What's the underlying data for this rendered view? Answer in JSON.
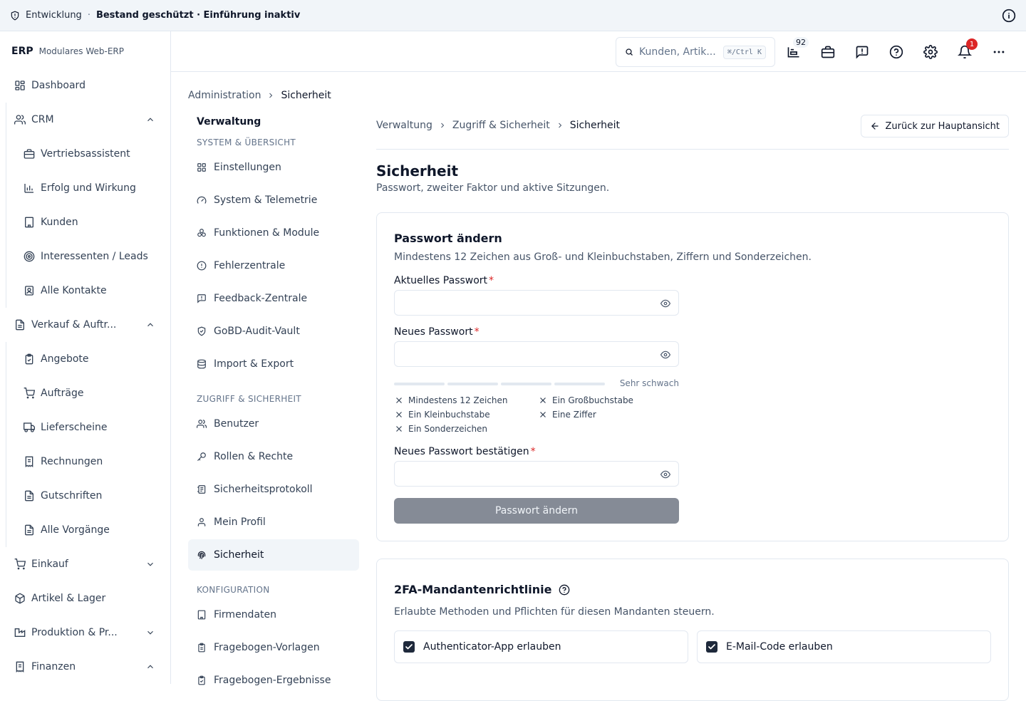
{
  "topbar": {
    "env": "Entwicklung",
    "separator": "·",
    "status": "Bestand geschützt · Einführung inaktiv"
  },
  "brand": {
    "logo": "ERP",
    "subtitle": "Modulares Web-ERP"
  },
  "sidebar": {
    "items": [
      {
        "label": "Dashboard",
        "icon": "dashboard-icon"
      },
      {
        "label": "CRM",
        "icon": "users-icon",
        "expanded": true
      },
      {
        "label": "Vertriebsassistent",
        "icon": "briefcase-icon"
      },
      {
        "label": "Erfolg und Wirkung",
        "icon": "bar-chart-icon"
      },
      {
        "label": "Kunden",
        "icon": "building-icon"
      },
      {
        "label": "Interessenten / Leads",
        "icon": "target-icon"
      },
      {
        "label": "Alle Kontakte",
        "icon": "contact-icon"
      },
      {
        "label": "Verkauf & Auftr...",
        "icon": "document-icon",
        "expanded": true
      },
      {
        "label": "Angebote",
        "icon": "clipboard-icon"
      },
      {
        "label": "Aufträge",
        "icon": "cart-icon"
      },
      {
        "label": "Lieferscheine",
        "icon": "truck-icon"
      },
      {
        "label": "Rechnungen",
        "icon": "receipt-icon"
      },
      {
        "label": "Gutschriften",
        "icon": "document-icon"
      },
      {
        "label": "Alle Vorgänge",
        "icon": "document-icon"
      },
      {
        "label": "Einkauf",
        "icon": "cart-icon",
        "expanded": false
      },
      {
        "label": "Artikel & Lager",
        "icon": "box-icon"
      },
      {
        "label": "Produktion & Pr...",
        "icon": "factory-icon",
        "expanded": false
      },
      {
        "label": "Finanzen",
        "icon": "receipt-icon",
        "expanded": true
      }
    ]
  },
  "header": {
    "search_placeholder": "Kunden, Artik...",
    "shortcut": "⌘/Ctrl K",
    "inbox_count": "92",
    "notification_count": "1"
  },
  "page_breadcrumb": {
    "parent": "Administration",
    "current": "Sicherheit"
  },
  "admin_nav": {
    "title": "Verwaltung",
    "sections": [
      {
        "label": "SYSTEM & ÜBERSICHT"
      },
      {
        "label": "ZUGRIFF & SICHERHEIT"
      },
      {
        "label": "KONFIGURATION"
      }
    ],
    "items": [
      {
        "label": "Einstellungen",
        "icon": "grid-icon"
      },
      {
        "label": "System & Telemetrie",
        "icon": "gauge-icon"
      },
      {
        "label": "Funktionen & Module",
        "icon": "modules-icon"
      },
      {
        "label": "Fehlerzentrale",
        "icon": "alert-icon"
      },
      {
        "label": "Feedback-Zentrale",
        "icon": "feedback-icon"
      },
      {
        "label": "GoBD-Audit-Vault",
        "icon": "shield-check-icon"
      },
      {
        "label": "Import & Export",
        "icon": "database-icon"
      },
      {
        "label": "Benutzer",
        "icon": "users-icon"
      },
      {
        "label": "Rollen & Rechte",
        "icon": "key-icon"
      },
      {
        "label": "Sicherheitsprotokoll",
        "icon": "log-icon"
      },
      {
        "label": "Mein Profil",
        "icon": "user-icon"
      },
      {
        "label": "Sicherheit",
        "icon": "fingerprint-icon",
        "active": true
      },
      {
        "label": "Firmendaten",
        "icon": "building-icon"
      },
      {
        "label": "Fragebogen-Vorlagen",
        "icon": "clipboard-icon"
      },
      {
        "label": "Fragebogen-Ergebnisse",
        "icon": "clipboard-check-icon"
      }
    ]
  },
  "content": {
    "breadcrumb": [
      "Verwaltung",
      "Zugriff & Sicherheit",
      "Sicherheit"
    ],
    "back_button": "Zurück zur Hauptansicht",
    "title": "Sicherheit",
    "subtitle": "Passwort, zweiter Faktor und aktive Sitzungen."
  },
  "password_card": {
    "title": "Passwort ändern",
    "description": "Mindestens 12 Zeichen aus Groß- und Kleinbuchstaben, Ziffern und Sonderzeichen.",
    "current_label": "Aktuelles Passwort",
    "new_label": "Neues Passwort",
    "confirm_label": "Neues Passwort bestätigen",
    "required_mark": "*",
    "strength_label": "Sehr schwach",
    "strength_level": 0,
    "rules": [
      {
        "label": "Mindestens 12 Zeichen",
        "met": false
      },
      {
        "label": "Ein Großbuchstabe",
        "met": false
      },
      {
        "label": "Ein Kleinbuchstabe",
        "met": false
      },
      {
        "label": "Eine Ziffer",
        "met": false
      },
      {
        "label": "Ein Sonderzeichen",
        "met": false
      }
    ],
    "submit_label": "Passwort ändern"
  },
  "twofa_card": {
    "title": "2FA-Mandantenrichtlinie",
    "description": "Erlaubte Methoden und Pflichten für diesen Mandanten steuern.",
    "options": [
      {
        "label": "Authenticator-App erlauben",
        "checked": true
      },
      {
        "label": "E-Mail-Code erlauben",
        "checked": true
      }
    ]
  },
  "colors": {
    "accent": "#0f172a",
    "required": "#dc2626",
    "disabled_button": "#858b96",
    "border": "#e2e8f0",
    "active_bg": "#f1f5f9"
  }
}
